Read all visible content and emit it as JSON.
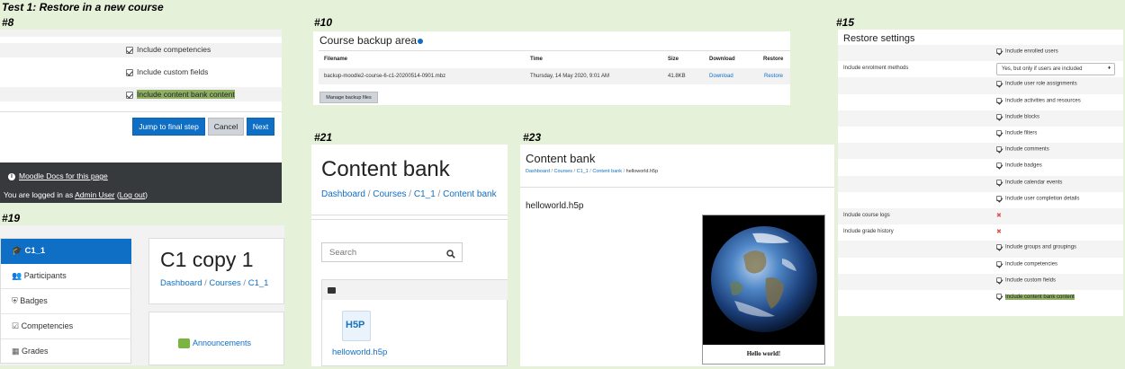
{
  "page_title": "Test 1: Restore in a new course",
  "colors": {
    "background": "#e6f1d9",
    "primary": "#0f6fc5",
    "highlight": "#8fb060",
    "footer": "#373a3c",
    "error": "#d9534f"
  },
  "p8": {
    "label": "#8",
    "items": [
      "Include competencies",
      "Include custom fields",
      "Include content bank content"
    ],
    "buttons": {
      "jump": "Jump to final step",
      "cancel": "Cancel",
      "next": "Next"
    },
    "footer": {
      "docs_link": "Moodle Docs for this page",
      "logged_prefix": "You are logged in as ",
      "user": "Admin User",
      "logout": "Log out",
      "logged_open": " (",
      "logged_close": ")"
    }
  },
  "p10": {
    "label": "#10",
    "title": "Course backup area",
    "headers": {
      "filename": "Filename",
      "time": "Time",
      "size": "Size",
      "download": "Download",
      "restore": "Restore"
    },
    "row": {
      "filename": "backup-moodle2-course-6-c1-20200514-0901.mbz",
      "time": "Thursday, 14 May 2020, 9:01 AM",
      "size": "41.8KB",
      "download": "Download",
      "restore": "Restore"
    },
    "manage_button": "Manage backup files"
  },
  "p15": {
    "label": "#15",
    "title": "Restore settings",
    "rows": [
      {
        "label": "",
        "type": "check",
        "value": "Include enrolled users"
      },
      {
        "label": "Include enrolment methods",
        "type": "select",
        "value": "Yes, but only if users are included"
      },
      {
        "label": "",
        "type": "check",
        "value": "Include user role assignments"
      },
      {
        "label": "",
        "type": "check",
        "value": "Include activities and resources"
      },
      {
        "label": "",
        "type": "check",
        "value": "Include blocks"
      },
      {
        "label": "",
        "type": "check",
        "value": "Include filters"
      },
      {
        "label": "",
        "type": "check",
        "value": "Include comments"
      },
      {
        "label": "",
        "type": "check",
        "value": "Include badges"
      },
      {
        "label": "",
        "type": "check",
        "value": "Include calendar events"
      },
      {
        "label": "",
        "type": "check",
        "value": "Include user completion details"
      },
      {
        "label": "Include course logs",
        "type": "cross",
        "value": ""
      },
      {
        "label": "Include grade history",
        "type": "cross",
        "value": ""
      },
      {
        "label": "",
        "type": "check",
        "value": "Include groups and groupings"
      },
      {
        "label": "",
        "type": "check",
        "value": "Include competencies"
      },
      {
        "label": "",
        "type": "check",
        "value": "Include custom fields"
      },
      {
        "label": "",
        "type": "check-hl",
        "value": "Include content bank content"
      }
    ]
  },
  "p19": {
    "label": "#19",
    "nav": [
      {
        "label": "C1_1",
        "icon": "graduation-cap-icon",
        "active": true
      },
      {
        "label": "Participants",
        "icon": "users-icon",
        "active": false
      },
      {
        "label": "Badges",
        "icon": "shield-icon",
        "active": false
      },
      {
        "label": "Competencies",
        "icon": "checkbox-icon",
        "active": false
      },
      {
        "label": "Grades",
        "icon": "table-icon",
        "active": false
      }
    ],
    "course_title": "C1 copy 1",
    "breadcrumb": [
      "Dashboard",
      "Courses",
      "C1_1"
    ],
    "announcements": "Announcements"
  },
  "p21": {
    "label": "#21",
    "title": "Content bank",
    "breadcrumb": [
      "Dashboard",
      "Courses",
      "C1_1",
      "Content bank"
    ],
    "search_placeholder": "Search",
    "file_name": "helloworld.h5p",
    "h5p_logo": "H5P"
  },
  "p23": {
    "label": "#23",
    "title": "Content bank",
    "breadcrumb": [
      "Dashboard",
      "Courses",
      "C1_1",
      "Content bank",
      "helloworld.h5p"
    ],
    "content_title": "helloworld.h5p",
    "caption": "Hello world!"
  }
}
